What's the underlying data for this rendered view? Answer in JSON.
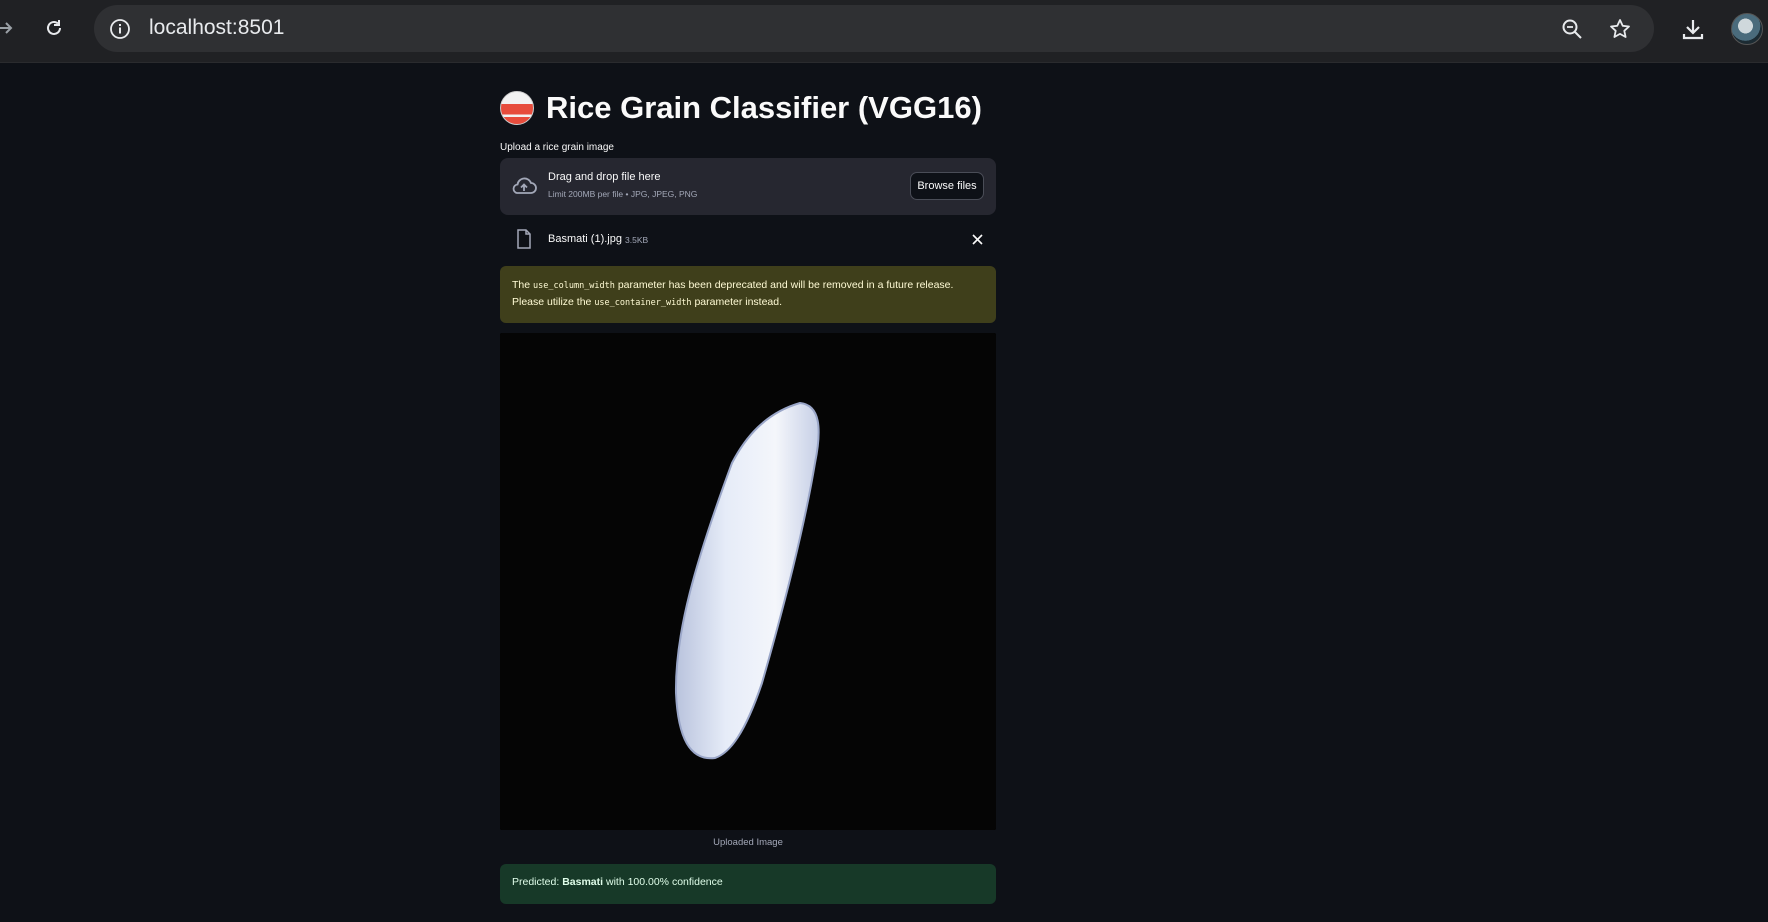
{
  "browser": {
    "url": "localhost:8501"
  },
  "app": {
    "title": "Rice Grain Classifier (VGG16)",
    "title_icon": "rice-bowl-emoji"
  },
  "uploader": {
    "label": "Upload a rice grain image",
    "drop_text": "Drag and drop file here",
    "limit_text": "Limit 200MB per file • JPG, JPEG, PNG",
    "browse_label": "Browse files",
    "file_name": "Basmati (1).jpg",
    "file_size": "3.5KB"
  },
  "warning": {
    "part1": "The ",
    "code1": "use_column_width",
    "part2": " parameter has been deprecated and will be removed in a future release. Please utilize the ",
    "code2": "use_container_width",
    "part3": " parameter instead."
  },
  "image": {
    "caption": "Uploaded Image"
  },
  "result": {
    "prefix": "Predicted: ",
    "label": "Basmati",
    "suffix": " with 100.00% confidence"
  },
  "colors": {
    "background": "#0e1117",
    "warning_bg": "#3f3f1b",
    "success_bg": "#173928"
  }
}
